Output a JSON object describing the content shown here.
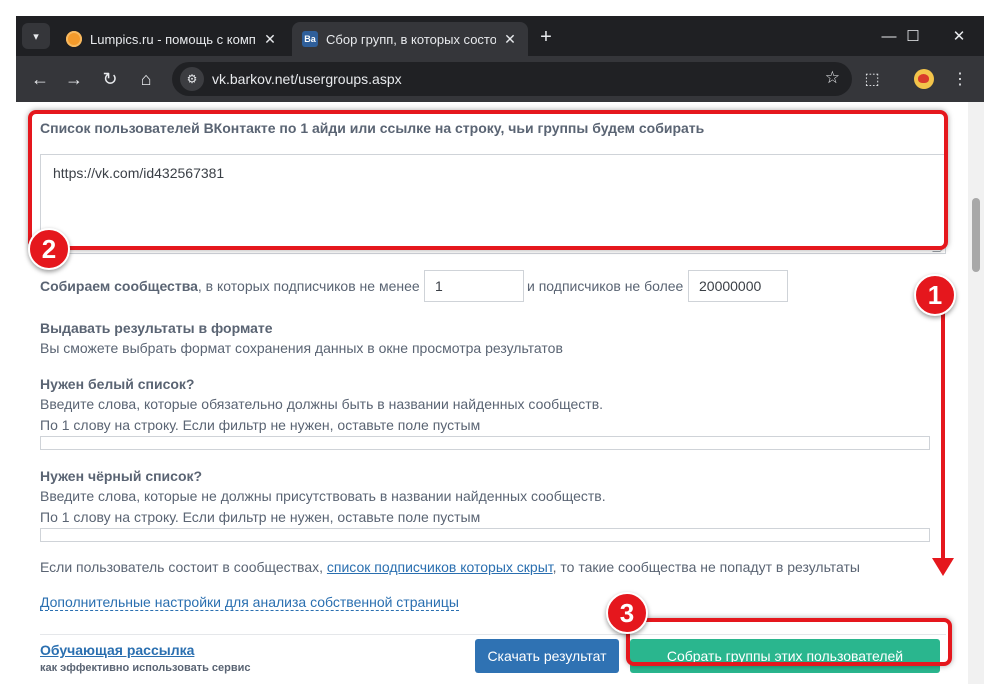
{
  "browser": {
    "tabs": [
      {
        "title": "Lumpics.ru - помощь с компьютером",
        "active": false,
        "favicon": "lumpics-icon"
      },
      {
        "title": "Сбор групп, в которых состоят",
        "active": true,
        "favicon": "vk-icon"
      }
    ],
    "url": "vk.barkov.net/usergroups.aspx"
  },
  "form": {
    "user_list_label": "Список пользователей ВКонтакте по 1 айди или ссылке на строку, чьи группы будем собирать",
    "user_list_value": "https://vk.com/id432567381",
    "collect_label_bold": "Собираем сообщества",
    "collect_label_rest": ", в которых подписчиков не менее",
    "min_subscribers": "1",
    "max_label": "и подписчиков не более",
    "max_subscribers": "20000000",
    "format_title": "Выдавать результаты в формате",
    "format_desc": "Вы сможете выбрать формат сохранения данных в окне просмотра результатов",
    "whitelist_title": "Нужен белый список?",
    "whitelist_desc1": "Введите слова, которые обязательно должны быть в названии найденных сообществ.",
    "whitelist_desc2": "По 1 слову на строку. Если фильтр не нужен, оставьте поле пустым",
    "blacklist_title": "Нужен чёрный список?",
    "blacklist_desc1": "Введите слова, которые не должны присутствовать в названии найденных сообществ.",
    "blacklist_desc2": "По 1 слову на строку. Если фильтр не нужен, оставьте поле пустым",
    "hidden_note_pre": "Если пользователь состоит в сообществах, ",
    "hidden_note_link": "список подписчиков которых скрыт",
    "hidden_note_post": ", то такие сообщества не попадут в результаты",
    "advanced_link": "Дополнительные настройки для анализа собственной страницы",
    "tutorial_link": "Обучающая рассылка",
    "tutorial_sub": "как эффективно использовать сервис",
    "download_button": "Скачать результат",
    "collect_button": "Собрать группы этих пользователей"
  },
  "annotations": {
    "badge_1": "1",
    "badge_2": "2",
    "badge_3": "3",
    "color": "#e5171d"
  }
}
